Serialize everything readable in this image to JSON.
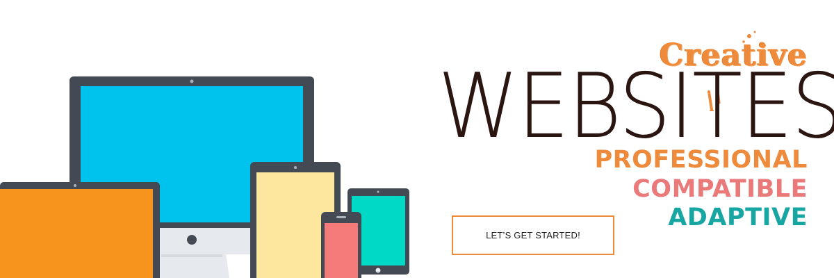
{
  "hero": {
    "brand_word": "Creative",
    "headline": "WEBSITES",
    "taglines": [
      {
        "text": "PROFESSIONAL",
        "color": "#ee8a3b"
      },
      {
        "text": "COMPATIBLE",
        "color": "#ea7a7a"
      },
      {
        "text": "ADAPTIVE",
        "color": "#17a6a1"
      }
    ],
    "cta_label": "LET’S GET STARTED!"
  },
  "colors": {
    "device_frame": "#434a54",
    "monitor_screen": "#00c3ed",
    "laptop_screen": "#f7941e",
    "tablet_screen": "#fde79e",
    "phone_screen": "#f57b7b",
    "mini_tablet_screen": "#00d9c6",
    "stand": "#e6e9ee",
    "accent_orange": "#ee8a3b",
    "headline_dark": "#2b1510"
  },
  "illustration": {
    "devices": [
      "desktop-monitor",
      "laptop",
      "tablet",
      "smartphone",
      "mini-tablet"
    ]
  }
}
